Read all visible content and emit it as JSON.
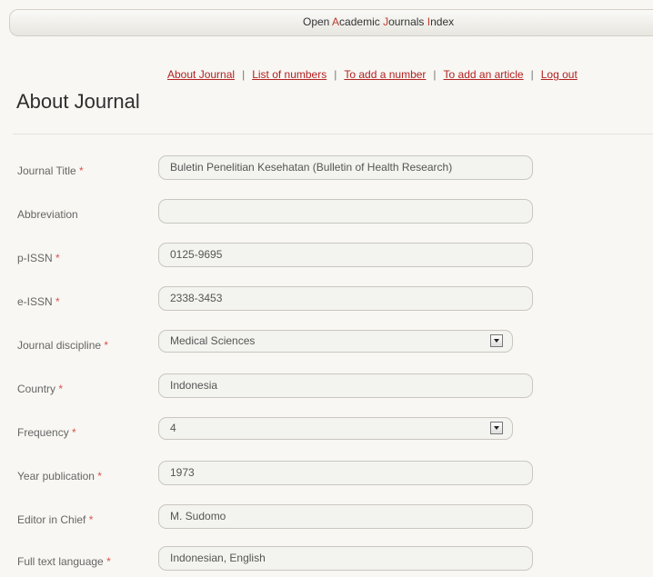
{
  "header": {
    "brand_segments": [
      {
        "text": "Open ",
        "hl": false
      },
      {
        "text": "A",
        "hl": true
      },
      {
        "text": "cademic ",
        "hl": false
      },
      {
        "text": "J",
        "hl": true
      },
      {
        "text": "ournals ",
        "hl": false
      },
      {
        "text": "I",
        "hl": true
      },
      {
        "text": "ndex",
        "hl": false
      }
    ]
  },
  "nav": {
    "links": [
      "About Journal",
      "List of numbers",
      "To add a number",
      "To add an article",
      "Log out"
    ],
    "separator": "|"
  },
  "page": {
    "title": "About Journal"
  },
  "form": {
    "required_mark": "*",
    "fields": [
      {
        "label": "Journal Title",
        "required": true,
        "type": "text",
        "value": "Buletin Penelitian Kesehatan (Bulletin of Health Research)"
      },
      {
        "label": "Abbreviation",
        "required": false,
        "type": "text",
        "value": ""
      },
      {
        "label": "p-ISSN",
        "required": true,
        "type": "text",
        "value": "0125-9695"
      },
      {
        "label": "e-ISSN",
        "required": true,
        "type": "text",
        "value": "2338-3453"
      },
      {
        "label": "Journal discipline",
        "required": true,
        "type": "select",
        "value": "Medical Sciences"
      },
      {
        "label": "Country",
        "required": true,
        "type": "text",
        "value": "Indonesia"
      },
      {
        "label": "Frequency",
        "required": true,
        "type": "select",
        "value": "4"
      },
      {
        "label": "Year publication",
        "required": true,
        "type": "text",
        "value": "1973"
      },
      {
        "label": "Editor in Chief",
        "required": true,
        "type": "text",
        "value": "M. Sudomo"
      },
      {
        "label": "Full text language",
        "required": true,
        "type": "text",
        "value": "Indonesian, English"
      }
    ]
  },
  "colors": {
    "accent": "#b22222",
    "required": "#d9534f",
    "background": "#f8f7f3"
  }
}
